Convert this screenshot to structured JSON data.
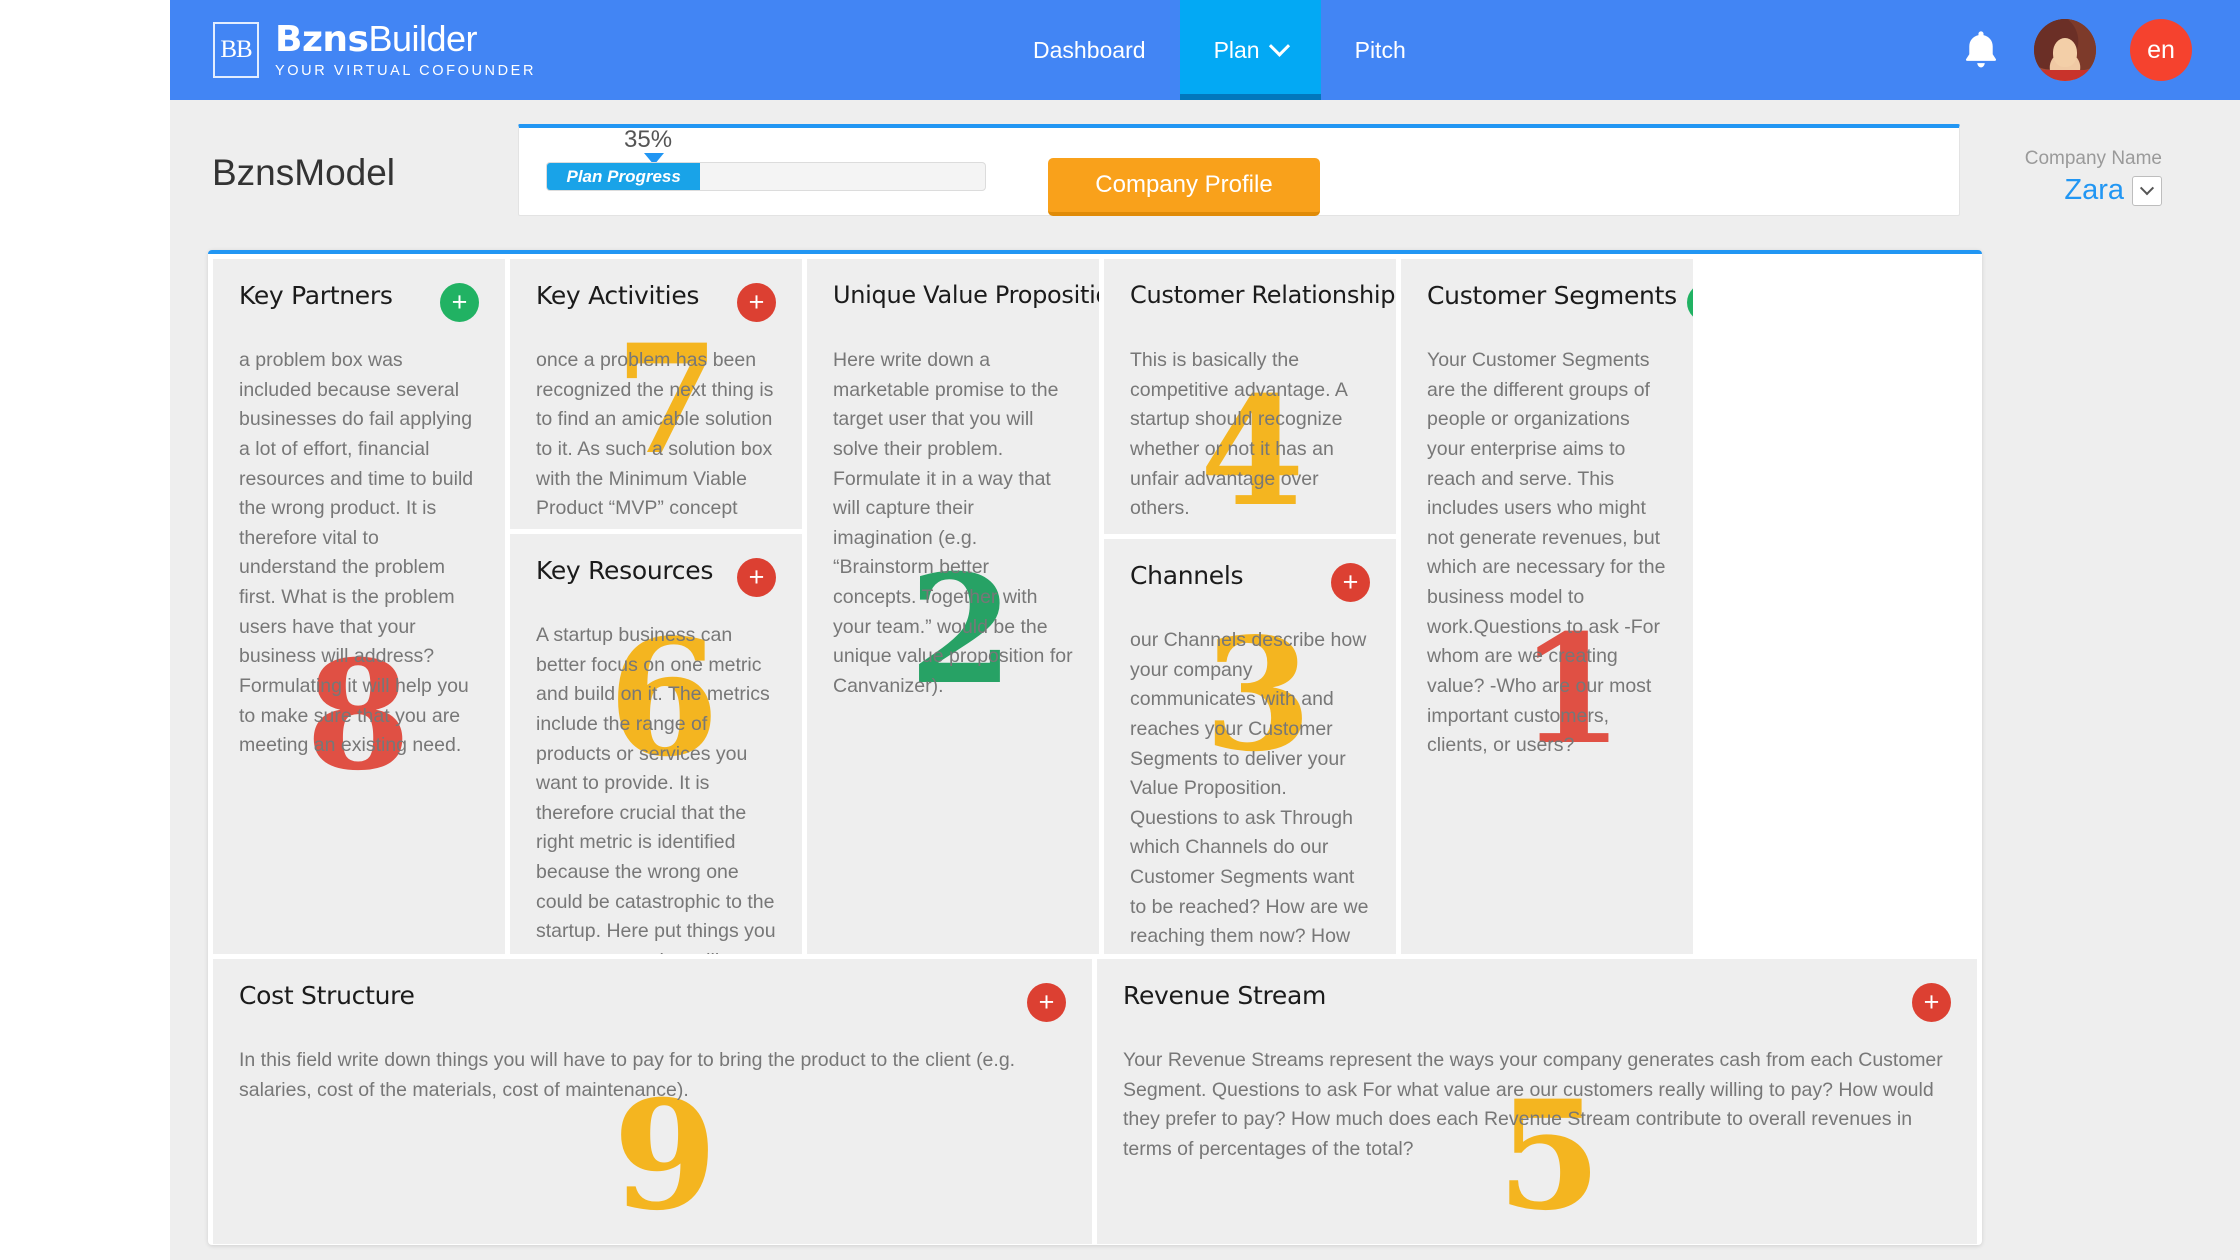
{
  "navbar": {
    "brand_badge": "BB",
    "brand_bold": "Bzns",
    "brand_light": "Builder",
    "brand_tagline": "YOUR VIRTUAL COFOUNDER",
    "menu": [
      {
        "label": "Dashboard",
        "active": false,
        "has_caret": false
      },
      {
        "label": "Plan",
        "active": true,
        "has_caret": true
      },
      {
        "label": "Pitch",
        "active": false,
        "has_caret": false
      }
    ],
    "language_badge": "en",
    "bell_icon": "bell-icon",
    "avatar_icon": "user-avatar",
    "nav_bg": "#4285f4",
    "nav_active_bg": "#03a9f4"
  },
  "subheader": {
    "page_title": "BznsModel",
    "progress": {
      "percent_label": "35%",
      "percent_value": 35,
      "bar_label": "Plan Progress",
      "fill_color": "#19a3e8"
    },
    "company_profile_button": "Company Profile",
    "company_name_label": "Company Name",
    "company_name_value": "Zara",
    "accent_color": "#f9a11b"
  },
  "canvas": {
    "cells": [
      {
        "id": "key-partners",
        "title": "Key Partners",
        "add_color": "#21b263",
        "watermark": {
          "text": "8",
          "color": "#e0483b"
        },
        "body": "a problem box was included because several businesses do fail applying a lot of effort, financial resources and time to build the wrong product. It is therefore vital to understand the problem first. What is the problem users have that your business will address? Formulating it will help you to make sure that you are meeting an existing need."
      },
      {
        "id": "key-activities",
        "title": "Key Activities",
        "add_color": "#dc4032",
        "watermark": {
          "text": "7",
          "color": "#f5b316"
        },
        "body": "once a problem has been recognized the next thing is to find an amicable solution to it. As such a solution box with the Minimum Viable Product “MVP” concept was included. How will your business help the users solve their problem? It is a purposefully small box — the solution needs to be concisely written and specific."
      },
      {
        "id": "key-resources",
        "title": "Key Resources",
        "add_color": "#dc4032",
        "watermark": {
          "text": "6",
          "color": "#f5b316"
        },
        "body": "A startup business can better focus on one metric and build on it. The metrics include the range of products or services you want to provide. It is therefore crucial that the right metric is identified because the wrong one could be catastrophic to the startup. Here put things you can measure that will reflect the state of your business or the strength of your proposal (e.g. at least"
      },
      {
        "id": "unique-value-proposition",
        "title": "Unique Value Proposition",
        "add_color": "#f5b316",
        "watermark": {
          "text": "2",
          "color": "#1d9e5e"
        },
        "body": "Here write down a marketable promise to the target user that you will solve their problem. Formulate it in a way that will capture their imagination (e.g. “Brainstorm better concepts. Together with your team.” would be the unique value proposition for Canvanizer)."
      },
      {
        "id": "customer-relationships",
        "title": "Customer Relationships",
        "add_color": "#dc4032",
        "watermark": {
          "text": "4",
          "color": "#f5b316"
        },
        "body": "This is basically the competitive advantage. A startup should recognize whether or not it has an unfair advantage over others."
      },
      {
        "id": "channels",
        "title": "Channels",
        "add_color": "#dc4032",
        "watermark": {
          "text": "3",
          "color": "#f5b316"
        },
        "body": "our Channels describe how your company communicates with and reaches your Customer Segments to deliver your Value Proposition. Questions to ask Through which Channels do our Customer Segments want to be reached? How are we reaching them now? How are our Channels integrated? Which ones work best? Which ones are most cost-"
      },
      {
        "id": "customer-segments",
        "title": "Customer Segments",
        "add_color": "#21b263",
        "watermark": {
          "text": "1",
          "color": "#e0483b"
        },
        "body": "Your Customer Segments are the different groups of people or organizations your enterprise aims to reach and serve. This includes users who might not generate revenues, but which are necessary for the business model to work.Questions to ask -For whom are we creating value? -Who are our most important customers, clients, or users?"
      },
      {
        "id": "cost-structure",
        "title": "Cost Structure",
        "add_color": "#dc4032",
        "watermark": {
          "text": "9",
          "color": "#f5b316"
        },
        "body": "In this field write down things you will have to pay for to bring the product to the client (e.g. salaries, cost of the materials, cost of maintenance)."
      },
      {
        "id": "revenue-stream",
        "title": "Revenue Stream",
        "add_color": "#dc4032",
        "watermark": {
          "text": "5",
          "color": "#f5b316"
        },
        "body": "Your Revenue Streams represent the ways your company generates cash from each Customer Segment. Questions to ask For what value are our customers really willing to pay? How would they prefer to pay? How much does each Revenue Stream contribute to overall revenues in terms of percentages of the total?"
      }
    ],
    "add_symbol": "+"
  }
}
